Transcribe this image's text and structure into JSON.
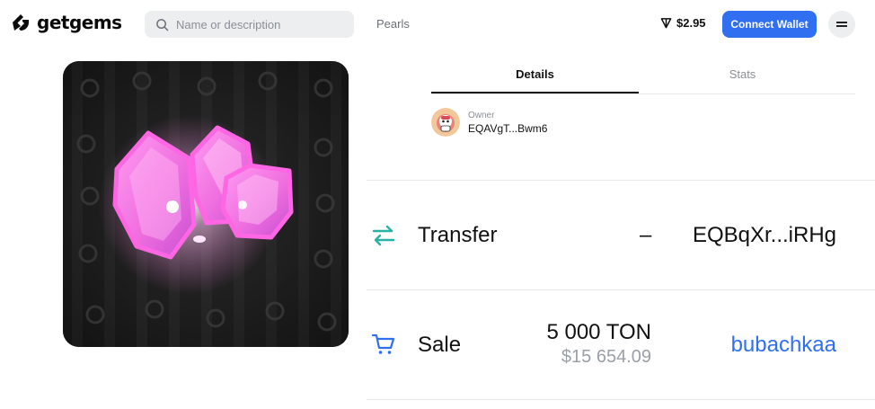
{
  "header": {
    "logo_text": "getgems",
    "search": {
      "placeholder": "Name or description",
      "value": ""
    },
    "nav_item": "Pearls",
    "balance": "$2.95",
    "balance_icon": "ton-icon",
    "connect_label": "Connect Wallet",
    "menu_icon": "hamburger-menu-icon",
    "accent": "#2f6ff0"
  },
  "nft": {
    "image_icon": "pink-pearl-crystals-image"
  },
  "tabs": [
    {
      "label": "Details",
      "active": true
    },
    {
      "label": "Stats",
      "active": false
    }
  ],
  "owner": {
    "label": "Owner",
    "address": "EQAVgT...Bwm6"
  },
  "activity": [
    {
      "icon": "transfer-arrows-icon",
      "type": "Transfer",
      "price": "–",
      "user": "EQBqXr...iRHg"
    },
    {
      "icon": "shopping-cart-icon",
      "type": "Sale",
      "price_ton": "5 000 TON",
      "price_usd": "$15 654.09",
      "user": "bubachkaa"
    }
  ]
}
